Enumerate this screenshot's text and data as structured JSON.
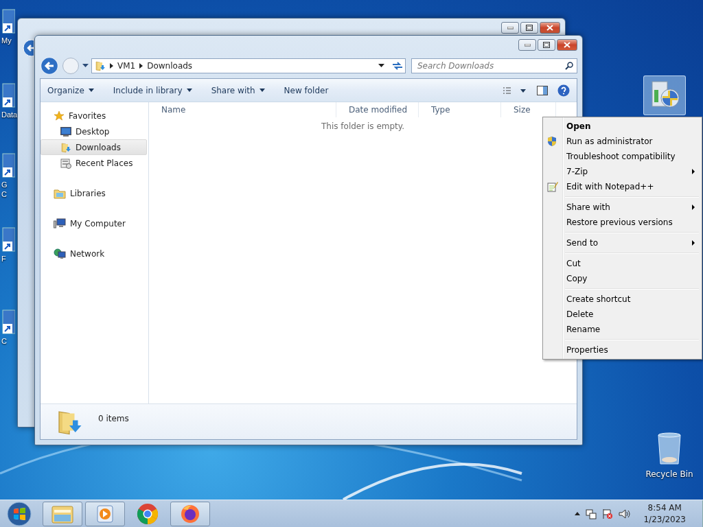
{
  "desktop_icons": [
    {
      "lines": [
        "My"
      ]
    },
    {
      "lines": [
        "Data"
      ]
    },
    {
      "lines": [
        "G",
        "C"
      ]
    },
    {
      "lines": [
        "F"
      ]
    },
    {
      "lines": [
        "C"
      ]
    }
  ],
  "window": {
    "breadcrumb": [
      "VM1",
      "Downloads"
    ],
    "search": {
      "placeholder": "Search Downloads"
    },
    "toolbar": [
      {
        "label": "Organize",
        "has_menu": true
      },
      {
        "label": "Include in library",
        "has_menu": true
      },
      {
        "label": "Share with",
        "has_menu": true
      },
      {
        "label": "New folder",
        "has_menu": false
      }
    ],
    "nav_tree": [
      {
        "label": "Favorites",
        "selected": false,
        "children": [
          {
            "label": "Desktop",
            "selected": false
          },
          {
            "label": "Downloads",
            "selected": true
          },
          {
            "label": "Recent Places",
            "selected": false
          }
        ]
      },
      {
        "label": "Libraries",
        "selected": false
      },
      {
        "label": "My Computer",
        "selected": false
      },
      {
        "label": "Network",
        "selected": false
      }
    ],
    "columns": [
      "Name",
      "Date modified",
      "Type",
      "Size"
    ],
    "empty_message": "This folder is empty.",
    "status": "0 items"
  },
  "context_menu": [
    {
      "kind": "item",
      "label": "Open",
      "default": true,
      "submenu": false
    },
    {
      "kind": "item",
      "label": "Run as administrator",
      "default": false,
      "submenu": false
    },
    {
      "kind": "item",
      "label": "Troubleshoot compatibility",
      "default": false,
      "submenu": false
    },
    {
      "kind": "item",
      "label": "7-Zip",
      "default": false,
      "submenu": true
    },
    {
      "kind": "item",
      "label": "Edit with Notepad++",
      "default": false,
      "submenu": false
    },
    {
      "kind": "separator"
    },
    {
      "kind": "item",
      "label": "Share with",
      "default": false,
      "submenu": true
    },
    {
      "kind": "item",
      "label": "Restore previous versions",
      "default": false,
      "submenu": false
    },
    {
      "kind": "separator"
    },
    {
      "kind": "item",
      "label": "Send to",
      "default": false,
      "submenu": true
    },
    {
      "kind": "separator"
    },
    {
      "kind": "item",
      "label": "Cut",
      "default": false,
      "submenu": false
    },
    {
      "kind": "item",
      "label": "Copy",
      "default": false,
      "submenu": false
    },
    {
      "kind": "separator"
    },
    {
      "kind": "item",
      "label": "Create shortcut",
      "default": false,
      "submenu": false
    },
    {
      "kind": "item",
      "label": "Delete",
      "default": false,
      "submenu": false
    },
    {
      "kind": "item",
      "label": "Rename",
      "default": false,
      "submenu": false
    },
    {
      "kind": "separator"
    },
    {
      "kind": "item",
      "label": "Properties",
      "default": false,
      "submenu": false
    }
  ],
  "recycle_bin": {
    "label": "Recycle Bin"
  },
  "taskbar": {
    "apps": [
      {
        "kind": "explorer",
        "running": true
      },
      {
        "kind": "media",
        "running": true
      },
      {
        "kind": "chrome",
        "running": false
      },
      {
        "kind": "firefox",
        "running": true
      }
    ],
    "time": "8:54 AM",
    "date": "1/23/2023"
  }
}
